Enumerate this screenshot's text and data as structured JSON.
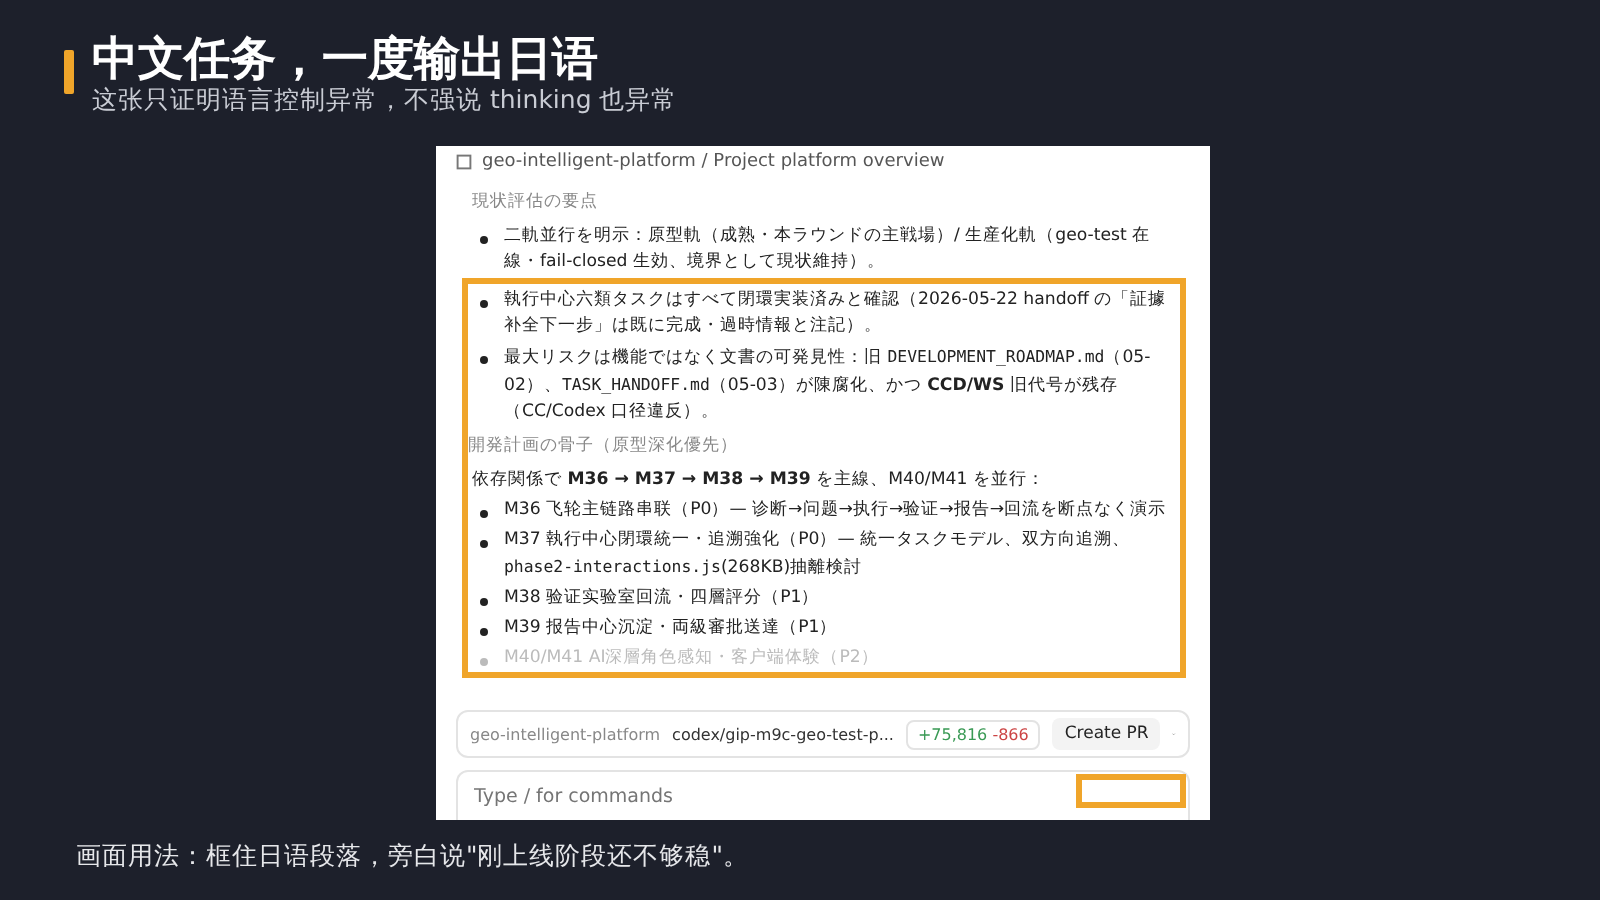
{
  "slide": {
    "title": "中文任务，一度输出日语",
    "subtitle": "这张只证明语言控制异常，不强说 thinking 也异常",
    "caption": "画面用法：框住日语段落，旁白说\"刚上线阶段还不够稳\"。"
  },
  "panel": {
    "breadcrumb": "geo-intelligent-platform / Project platform overview",
    "blocks": [
      {
        "kind": "heading",
        "highlighted": false,
        "parts": [
          {
            "kind": "text",
            "text": "現状評估の要点"
          }
        ]
      },
      {
        "kind": "bullet",
        "highlighted": false,
        "parts": [
          {
            "kind": "text",
            "text": "二軌並行を明示：原型軌（成熟・本ラウンドの主戦場）/ 生産化軌（geo-test 在線・fail-closed 生効、境界として現状維持）。"
          }
        ]
      },
      {
        "kind": "bullet",
        "highlighted": true,
        "parts": [
          {
            "kind": "text",
            "text": "執行中心六類タスクはすべて閉環実装済みと確認（2026-05-22 handoff の「証據补全下一步」は既に完成・過時情報と注記）。"
          }
        ]
      },
      {
        "kind": "bullet",
        "highlighted": true,
        "parts": [
          {
            "kind": "text",
            "text": "最大リスクは機能ではなく文書の可発見性：旧 "
          },
          {
            "kind": "code",
            "text": "DEVELOPMENT_ROADMAP.md"
          },
          {
            "kind": "text",
            "text": "（05-02）、"
          },
          {
            "kind": "code",
            "text": "TASK_HANDOFF.md"
          },
          {
            "kind": "text",
            "text": "（05-03）が陳腐化、かつ **CCD/WS** 旧代号が残存（CC/Codex 口径違反）。"
          }
        ]
      },
      {
        "kind": "heading",
        "highlighted": true,
        "parts": [
          {
            "kind": "text",
            "text": "開発計画の骨子（原型深化優先）"
          }
        ]
      },
      {
        "kind": "paragraph",
        "highlighted": true,
        "parts": [
          {
            "kind": "text",
            "text": "依存関係で **M36 → M37 → M38 → M39** を主線、M40/M41 を並行："
          }
        ]
      },
      {
        "kind": "bullet",
        "highlighted": true,
        "parts": [
          {
            "kind": "text",
            "text": "M36 飞轮主链路串联（P0）— 诊断→问题→执行→验证→报告→回流を断点なく演示"
          }
        ]
      },
      {
        "kind": "bullet",
        "highlighted": true,
        "parts": [
          {
            "kind": "text",
            "text": "M37 執行中心閉環統一・追溯強化（P0）— 統一タスクモデル、双方向追溯、"
          },
          {
            "kind": "code",
            "text": "phase2-interactions.js"
          },
          {
            "kind": "text",
            "text": "(268KB)抽離検討"
          }
        ]
      },
      {
        "kind": "bullet",
        "highlighted": true,
        "parts": [
          {
            "kind": "text",
            "text": "M38 验证实验室回流・四層評分（P1）"
          }
        ]
      },
      {
        "kind": "bullet",
        "highlighted": true,
        "parts": [
          {
            "kind": "text",
            "text": "M39 报告中心沉淀・両級審批送達（P1）"
          }
        ]
      },
      {
        "kind": "faded",
        "highlighted": true,
        "parts": [
          {
            "kind": "text",
            "text": "M40/M41 AI深層角色感知・客户端体験（P2）"
          }
        ]
      }
    ],
    "repo": "geo-intelligent-platform",
    "branch": "codex/gip-m9c-geo-test-p...",
    "additions": "+75,816",
    "deletions": "-866",
    "create_button": "Create PR",
    "input": {
      "placeholder": "Type / for commands"
    }
  }
}
